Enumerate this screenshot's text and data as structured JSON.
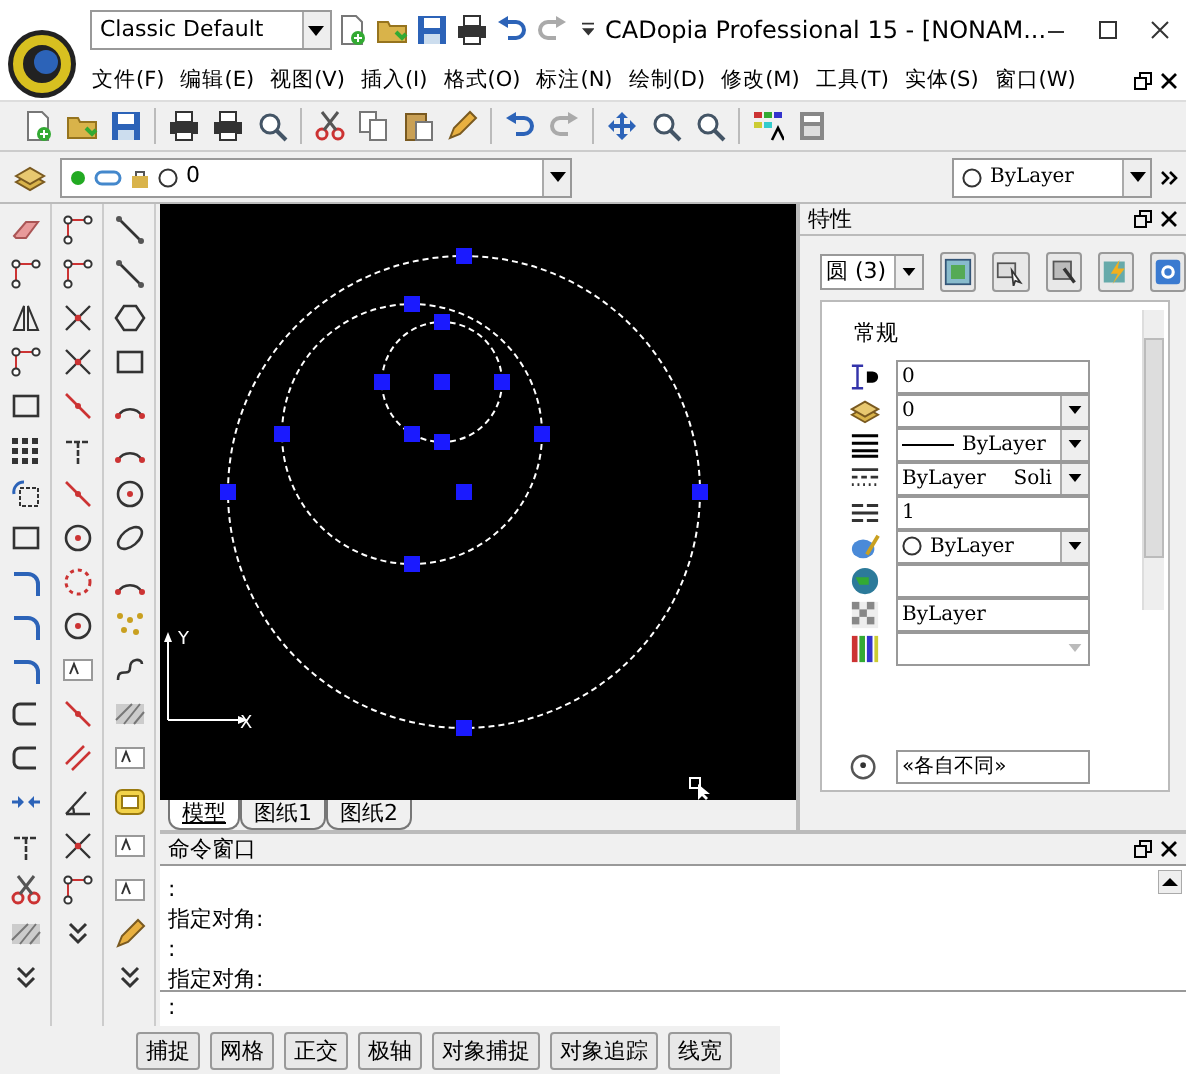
{
  "title_bar": {
    "workspace": "Classic Default",
    "title": "CADopia Professional 15 - [NONAM..."
  },
  "menu": [
    "文件(F)",
    "编辑(E)",
    "视图(V)",
    "插入(I)",
    "格式(O)",
    "标注(N)",
    "绘制(D)",
    "修改(M)",
    "工具(T)",
    "实体(S)",
    "窗口(W)"
  ],
  "layer_bar": {
    "layer": "0",
    "color_setting": "ByLayer"
  },
  "layout_tabs": [
    {
      "label": "模型",
      "selected": true
    },
    {
      "label": "图纸1",
      "selected": false
    },
    {
      "label": "图纸2",
      "selected": false
    }
  ],
  "canvas": {
    "axis_x": "X",
    "axis_y": "Y"
  },
  "properties": {
    "title": "特性",
    "selection": "圆 (3)",
    "section": "常规",
    "rows": [
      {
        "kind": "text",
        "value": "0"
      },
      {
        "kind": "dropdown",
        "value": "0"
      },
      {
        "kind": "line-dropdown",
        "value": "ByLayer"
      },
      {
        "kind": "dropdown",
        "value": "ByLayer",
        "value_2": "Soli"
      },
      {
        "kind": "text",
        "value": "1"
      },
      {
        "kind": "color-dropdown",
        "value": "ByLayer"
      },
      {
        "kind": "text"
      },
      {
        "kind": "text",
        "value": "ByLayer"
      },
      {
        "kind": "disabled-dropdown"
      }
    ],
    "footer_value": "«各自不同»"
  },
  "command_window": {
    "title": "命令窗口",
    "lines": [
      ":",
      "指定对角:",
      ":",
      "指定对角:"
    ],
    "prompt": ":"
  },
  "status_buttons": [
    "捕捉",
    "网格",
    "正交",
    "极轴",
    "对象捕捉",
    "对象追踪",
    "线宽"
  ]
}
